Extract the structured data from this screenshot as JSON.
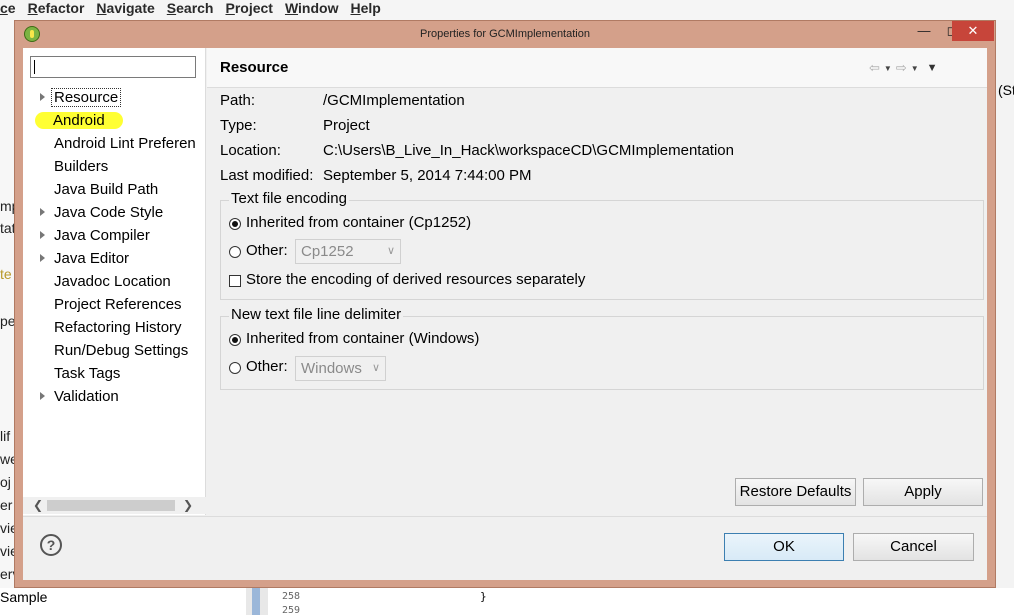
{
  "ide": {
    "menu": [
      "ce",
      "Refactor",
      "Navigate",
      "Search",
      "Project",
      "Window",
      "Help"
    ],
    "left_fragments": [
      "mp",
      "tat",
      "te",
      "pe",
      "lif",
      "we",
      "oj",
      "er",
      "vie",
      "vie",
      "erv"
    ],
    "right_fragment": "(St",
    "bottom_text": "Sample",
    "line_numbers": [
      "258",
      "259"
    ],
    "brace": "}"
  },
  "dialog": {
    "title": "Properties for GCMImplementation",
    "filter_placeholder": "",
    "tree": [
      {
        "label": "Resource",
        "expandable": true
      },
      {
        "label": "Android",
        "expandable": false
      },
      {
        "label": "Android Lint Preferen",
        "expandable": false
      },
      {
        "label": "Builders",
        "expandable": false
      },
      {
        "label": "Java Build Path",
        "expandable": false
      },
      {
        "label": "Java Code Style",
        "expandable": true
      },
      {
        "label": "Java Compiler",
        "expandable": true
      },
      {
        "label": "Java Editor",
        "expandable": true
      },
      {
        "label": "Javadoc Location",
        "expandable": false
      },
      {
        "label": "Project References",
        "expandable": false
      },
      {
        "label": "Refactoring History",
        "expandable": false
      },
      {
        "label": "Run/Debug Settings",
        "expandable": false
      },
      {
        "label": "Task Tags",
        "expandable": false
      },
      {
        "label": "Validation",
        "expandable": true
      }
    ],
    "page_title": "Resource",
    "info": {
      "path_label": "Path:",
      "path_value": "/GCMImplementation",
      "type_label": "Type:",
      "type_value": "Project",
      "location_label": "Location:",
      "location_value": "C:\\Users\\B_Live_In_Hack\\workspaceCD\\GCMImplementation",
      "modified_label": "Last modified:",
      "modified_value": "September 5, 2014 7:44:00 PM"
    },
    "encoding": {
      "title": "Text file encoding",
      "inherited_label": "Inherited from container (Cp1252)",
      "other_label": "Other:",
      "other_value": "Cp1252",
      "derived_label": "Store the encoding of derived resources separately"
    },
    "delimiter": {
      "title": "New text file line delimiter",
      "inherited_label": "Inherited from container (Windows)",
      "other_label": "Other:",
      "other_value": "Windows"
    },
    "buttons": {
      "restore": "Restore Defaults",
      "apply": "Apply",
      "ok": "OK",
      "cancel": "Cancel"
    },
    "colors": {
      "frame": "#d4a08a",
      "highlight": "#ffff33",
      "close": "#c7453a"
    }
  }
}
